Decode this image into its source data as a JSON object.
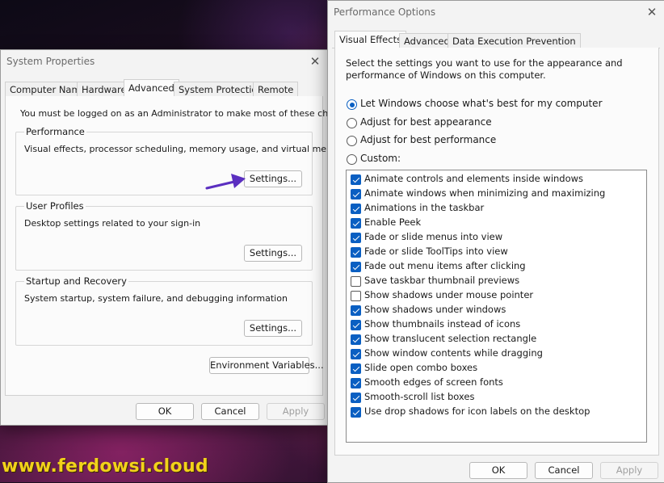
{
  "watermark": "www.ferdowsi.cloud",
  "system_properties": {
    "title": "System Properties",
    "tabs": [
      "Computer Name",
      "Hardware",
      "Advanced",
      "System Protection",
      "Remote"
    ],
    "active_tab": "Advanced",
    "admin_note": "You must be logged on as an Administrator to make most of these changes.",
    "performance": {
      "title": "Performance",
      "desc": "Visual effects, processor scheduling, memory usage, and virtual memory",
      "button": "Settings..."
    },
    "user_profiles": {
      "title": "User Profiles",
      "desc": "Desktop settings related to your sign-in",
      "button": "Settings..."
    },
    "startup": {
      "title": "Startup and Recovery",
      "desc": "System startup, system failure, and debugging information",
      "button": "Settings..."
    },
    "env_button": "Environment Variables...",
    "ok": "OK",
    "cancel": "Cancel",
    "apply": "Apply"
  },
  "performance_options": {
    "title": "Performance Options",
    "tabs": [
      "Visual Effects",
      "Advanced",
      "Data Execution Prevention"
    ],
    "active_tab": "Visual Effects",
    "intro": [
      "Select the settings you want to use for the appearance and",
      "performance of Windows on this computer."
    ],
    "radios": [
      {
        "label": "Let Windows choose what's best for my computer",
        "checked": true
      },
      {
        "label": "Adjust for best appearance",
        "checked": false
      },
      {
        "label": "Adjust for best performance",
        "checked": false
      },
      {
        "label": "Custom:",
        "checked": false
      }
    ],
    "effects": [
      {
        "label": "Animate controls and elements inside windows",
        "checked": true
      },
      {
        "label": "Animate windows when minimizing and maximizing",
        "checked": true
      },
      {
        "label": "Animations in the taskbar",
        "checked": true
      },
      {
        "label": "Enable Peek",
        "checked": true
      },
      {
        "label": "Fade or slide menus into view",
        "checked": true
      },
      {
        "label": "Fade or slide ToolTips into view",
        "checked": true
      },
      {
        "label": "Fade out menu items after clicking",
        "checked": true
      },
      {
        "label": "Save taskbar thumbnail previews",
        "checked": false
      },
      {
        "label": "Show shadows under mouse pointer",
        "checked": false
      },
      {
        "label": "Show shadows under windows",
        "checked": true
      },
      {
        "label": "Show thumbnails instead of icons",
        "checked": true
      },
      {
        "label": "Show translucent selection rectangle",
        "checked": true
      },
      {
        "label": "Show window contents while dragging",
        "checked": true
      },
      {
        "label": "Slide open combo boxes",
        "checked": true
      },
      {
        "label": "Smooth edges of screen fonts",
        "checked": true
      },
      {
        "label": "Smooth-scroll list boxes",
        "checked": true
      },
      {
        "label": "Use drop shadows for icon labels on the desktop",
        "checked": true
      }
    ],
    "ok": "OK",
    "cancel": "Cancel",
    "apply": "Apply"
  },
  "colors": {
    "accent": "#0a5fc2",
    "arrow": "#5b2fc0",
    "watermark": "#f2d21a"
  },
  "icons": {
    "close": "close-icon",
    "arrow": "arrow-annotation-icon"
  }
}
